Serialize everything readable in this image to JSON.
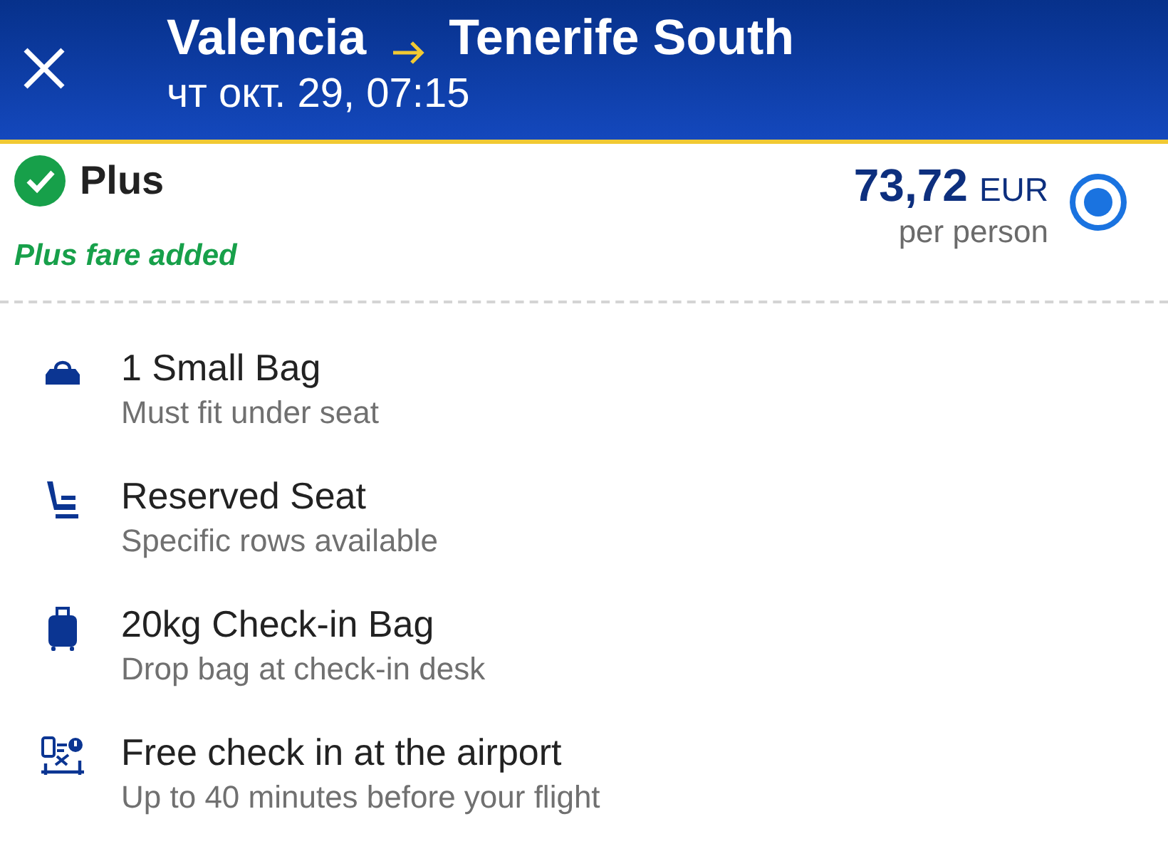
{
  "header": {
    "origin": "Valencia",
    "destination": "Tenerife South",
    "date_time": "чт окт. 29, 07:15"
  },
  "fare": {
    "name": "Plus",
    "included": true,
    "status": "Plus fare added",
    "price": "73,72",
    "currency": "EUR",
    "price_note": "per person",
    "selected": true
  },
  "features": [
    {
      "kind": "small-bag",
      "title": "1 Small Bag",
      "subtitle": "Must fit under seat"
    },
    {
      "kind": "seat",
      "title": "Reserved Seat",
      "subtitle": "Specific rows available"
    },
    {
      "kind": "checked-bag",
      "title": "20kg Check-in Bag",
      "subtitle": "Drop bag at check-in desk"
    },
    {
      "kind": "airport-checkin",
      "title": "Free check in at the airport",
      "subtitle": "Up to 40 minutes before your flight"
    }
  ]
}
